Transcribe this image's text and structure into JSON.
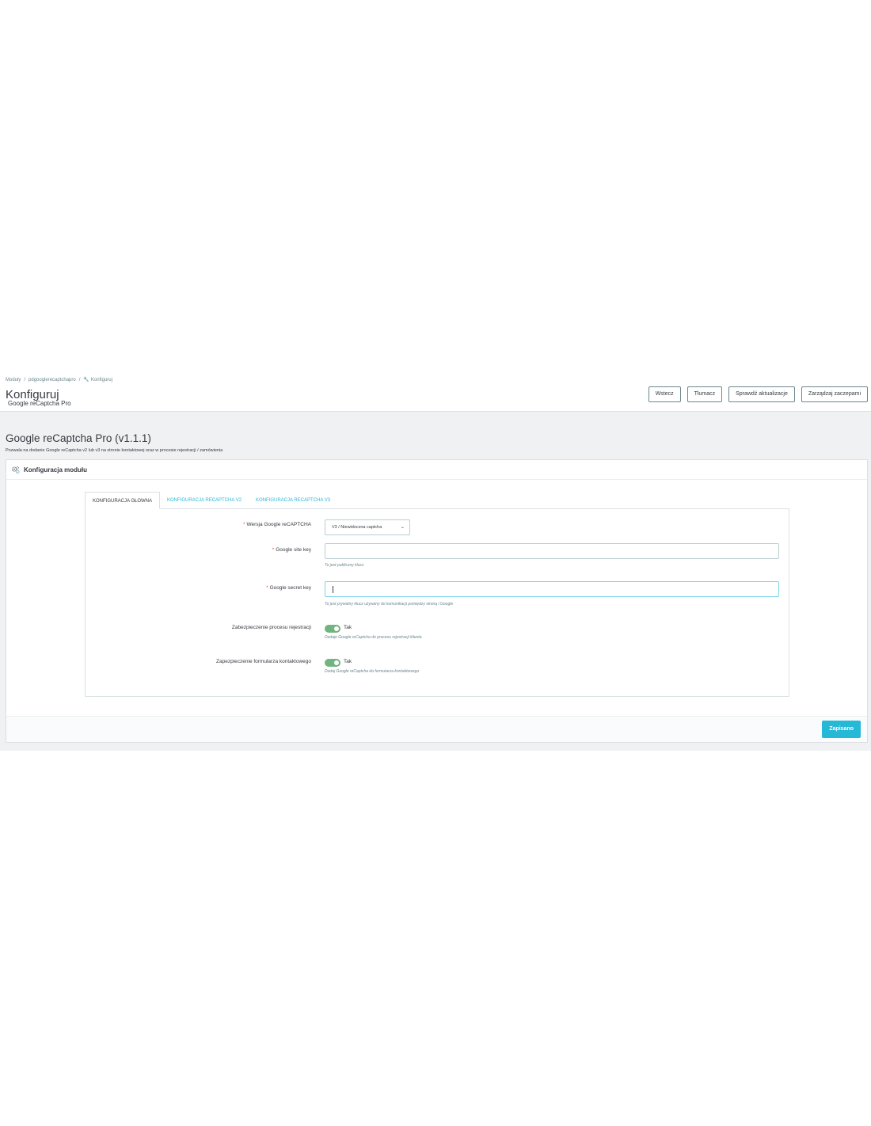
{
  "breadcrumb": {
    "items": [
      "Moduły",
      "pdgooglerecaptchapro",
      "Konfiguruj"
    ],
    "separator": "/"
  },
  "header": {
    "title": "Konfiguruj",
    "subtitle": "Google reCaptcha Pro",
    "buttons": [
      "Wstecz",
      "Tłumacz",
      "Sprawdź aktualizacje",
      "Zarządzaj zaczepami"
    ]
  },
  "module": {
    "title": "Google reCaptcha Pro (v1.1.1)",
    "description": "Pozwala na dodanie Google reCaptcha v2 lub v3 na stronie kontaktowej oraz w procesie rejestracji / zamówienia"
  },
  "panel": {
    "title": "Konfiguracja modułu",
    "icon": "gears-icon",
    "tabs": [
      "KONFIGURACJA GŁOWNA",
      "KONFIGURACJA RECAPTCHA V2",
      "KONFIGURACJA RECAPTCHA V3"
    ],
    "active_tab": 0,
    "fields": {
      "version": {
        "label": "Wersja Google reCAPTCHA",
        "required": true,
        "value": "V3 / Niewidoczna captcha"
      },
      "site_key": {
        "label": "Google site key",
        "required": true,
        "value": "",
        "help": "To jest publiczny klucz"
      },
      "secret_key": {
        "label": "Google secret key",
        "required": true,
        "value": "",
        "help": "To jest prywatny klucz używany do komunikacji pomiędzy stroną i Google"
      },
      "registration": {
        "label": "Zabezpieczenie procesu rejestracji",
        "state": "Tak",
        "enabled": true,
        "help": "Dodaje Google reCaptcha do procesu rejestracji klienta"
      },
      "contact": {
        "label": "Zapezpieczenie formularza kontaktowego",
        "state": "Tak",
        "enabled": true,
        "help": "Dodaj Google reCaptcha do formularza kontaktowego"
      }
    },
    "save_label": "Zapisano"
  },
  "colors": {
    "accent": "#25b9d7",
    "toggle_on": "#70b580",
    "required": "#f54c3e",
    "background": "#eff1f2"
  }
}
